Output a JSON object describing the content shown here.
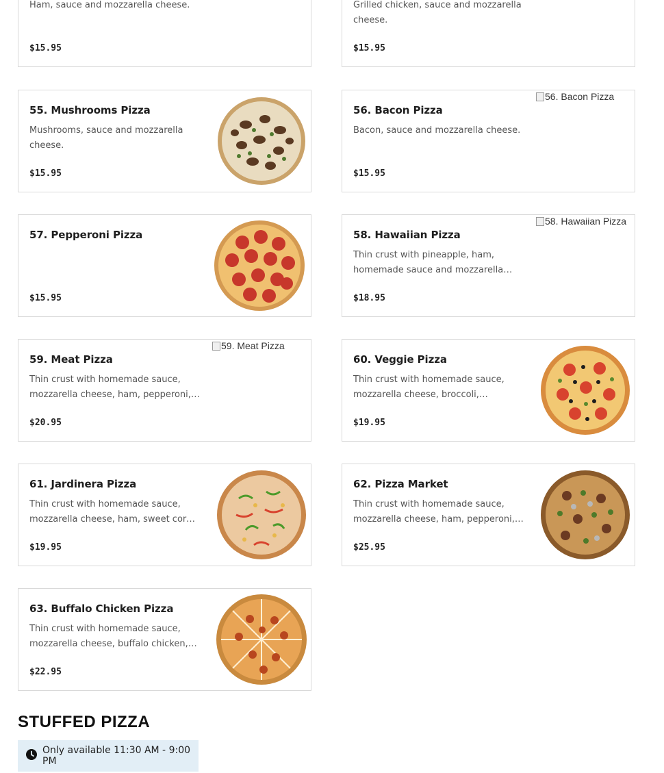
{
  "menu_items": [
    {
      "id": "item-top-left",
      "title": "",
      "description": "Ham, sauce and mozzarella cheese.",
      "price": "$15.95"
    },
    {
      "id": "item-top-right",
      "title": "",
      "description": "Grilled chicken, sauce and mozzarella cheese.",
      "price": "$15.95"
    },
    {
      "id": "item-55",
      "title": "55. Mushrooms Pizza",
      "description": "Mushrooms, sauce and mozzarella cheese.",
      "price": "$15.95",
      "image": "mushroom-pizza"
    },
    {
      "id": "item-56",
      "title": "56. Bacon Pizza",
      "description": "Bacon, sauce and mozzarella cheese.",
      "price": "$15.95",
      "image_alt": "56. Bacon Pizza"
    },
    {
      "id": "item-57",
      "title": "57. Pepperoni Pizza",
      "description": "",
      "price": "$15.95",
      "image": "pepperoni-pizza"
    },
    {
      "id": "item-58",
      "title": "58. Hawaiian Pizza",
      "description": "Thin crust with pineapple, ham, homemade sauce and mozzarella cheese.",
      "price": "$18.95",
      "image_alt": "58. Hawaiian Pizza"
    },
    {
      "id": "item-59",
      "title": "59. Meat Pizza",
      "description": "Thin crust with homemade sauce, mozzarella cheese, ham, pepperoni, sausage.",
      "price": "$20.95",
      "image_alt": "59. Meat Pizza"
    },
    {
      "id": "item-60",
      "title": "60. Veggie Pizza",
      "description": "Thin crust with homemade sauce, mozzarella cheese, broccoli, tomatoes.",
      "price": "$19.95",
      "image": "veggie-pizza"
    },
    {
      "id": "item-61",
      "title": "61. Jardinera Pizza",
      "description": "Thin crust with homemade sauce, mozzarella cheese, ham, sweet corn, peppers.",
      "price": "$19.95",
      "image": "jardinera-pizza"
    },
    {
      "id": "item-62",
      "title": "62. Pizza Market",
      "description": "Thin crust with homemade sauce, mozzarella cheese, ham, pepperoni, mushrooms.",
      "price": "$25.95",
      "image": "market-pizza"
    },
    {
      "id": "item-63",
      "title": "63. Buffalo Chicken Pizza",
      "description": "Thin crust with homemade sauce, mozzarella cheese, buffalo chicken, onions.",
      "price": "$22.95",
      "image": "buffalo-chicken-pizza"
    }
  ],
  "section": {
    "title": "STUFFED PIZZA",
    "availability": "Only available 11:30 AM - 9:00 PM",
    "availability_icon": "clock-icon"
  },
  "colors": {
    "border": "#d9d9d9",
    "availability_bg": "#e2eef6"
  }
}
